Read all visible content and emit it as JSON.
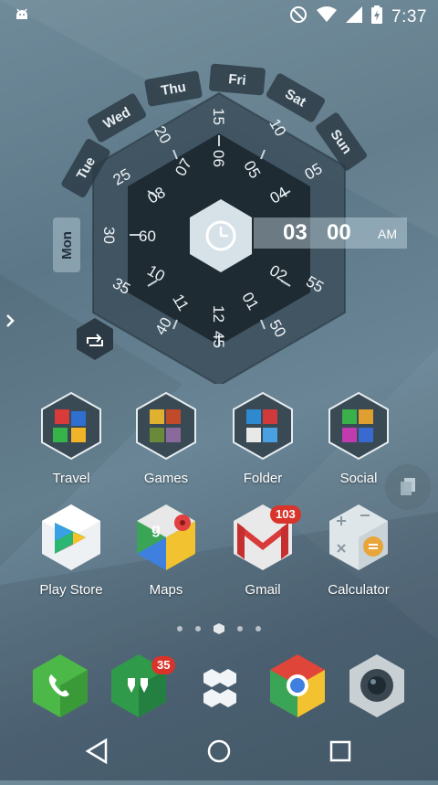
{
  "status": {
    "time": "7:37",
    "icons": [
      "android-icon",
      "no-disturb-icon",
      "wifi-icon",
      "signal-icon",
      "battery-charging-icon"
    ]
  },
  "clock_widget": {
    "days": [
      "Mon",
      "Tue",
      "Wed",
      "Thu",
      "Fri",
      "Sat",
      "Sun"
    ],
    "active_day": "Mon",
    "hour": "03",
    "minute": "00",
    "ampm": "AM",
    "hour_ring": [
      "12",
      "01",
      "02",
      "03",
      "04",
      "05",
      "06",
      "07",
      "08",
      "09",
      "10",
      "11"
    ],
    "hour_ring_shown": [
      "12",
      "01",
      "02",
      "04",
      "05",
      "06",
      "07",
      "08",
      "10",
      "11"
    ],
    "minute_ring": [
      "15",
      "10",
      "05",
      "55",
      "50",
      "45",
      "40",
      "35",
      "30",
      "25",
      "20"
    ],
    "center_icon": "clock-icon",
    "repeat_icon": "repeat-icon"
  },
  "apps_row1": [
    {
      "label": "Travel",
      "icon": "travel-folder-icon"
    },
    {
      "label": "Games",
      "icon": "games-folder-icon"
    },
    {
      "label": "Folder",
      "icon": "folder-icon"
    },
    {
      "label": "Social",
      "icon": "social-folder-icon"
    }
  ],
  "apps_row2": [
    {
      "label": "Play Store",
      "icon": "play-store-icon"
    },
    {
      "label": "Maps",
      "icon": "maps-icon"
    },
    {
      "label": "Gmail",
      "icon": "gmail-icon",
      "badge": "103"
    },
    {
      "label": "Calculator",
      "icon": "calculator-icon"
    }
  ],
  "dock": [
    {
      "icon": "phone-icon"
    },
    {
      "icon": "hangouts-icon",
      "badge": "35"
    },
    {
      "icon": "app-drawer-icon"
    },
    {
      "icon": "chrome-icon"
    },
    {
      "icon": "camera-icon"
    }
  ],
  "colors": {
    "hex_dark": "#2b3a44",
    "hex_darker": "#1f2b33",
    "badge_red": "#d9342b"
  }
}
